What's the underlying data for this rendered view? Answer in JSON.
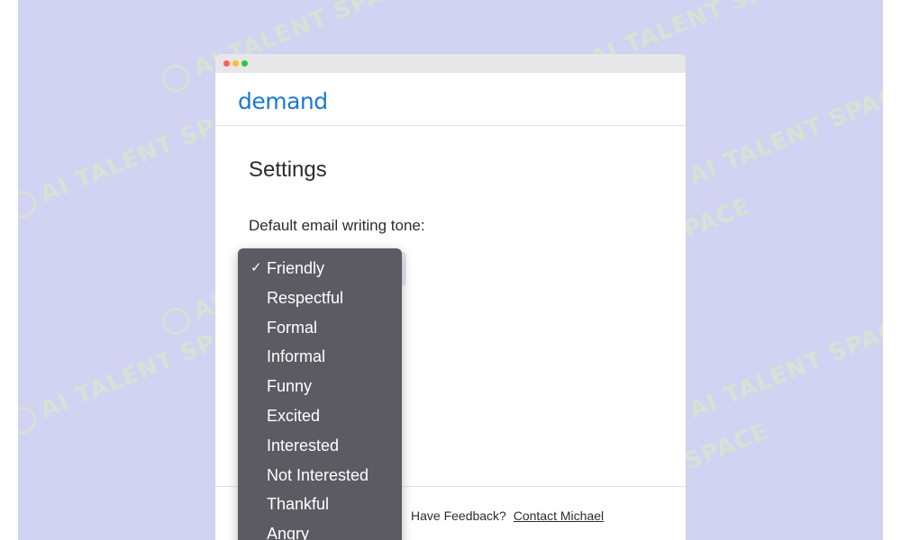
{
  "window": {
    "logo": "demand"
  },
  "settings": {
    "title": "Settings",
    "tone_label": "Default email writing tone:"
  },
  "dropdown": {
    "selected": "Friendly",
    "check_glyph": "✓",
    "options": [
      "Friendly",
      "Respectful",
      "Formal",
      "Informal",
      "Funny",
      "Excited",
      "Interested",
      "Not Interested",
      "Thankful",
      "Angry"
    ]
  },
  "footer": {
    "feedback_text": "Have Feedback?",
    "contact_link": "Contact Michael"
  },
  "watermark": {
    "text": "AI TALENT SPACE"
  },
  "colors": {
    "background": "#d2d2f3",
    "logo": "#1b78d0",
    "menu_bg": "#5c5a63",
    "menu_text": "#ffffff"
  }
}
